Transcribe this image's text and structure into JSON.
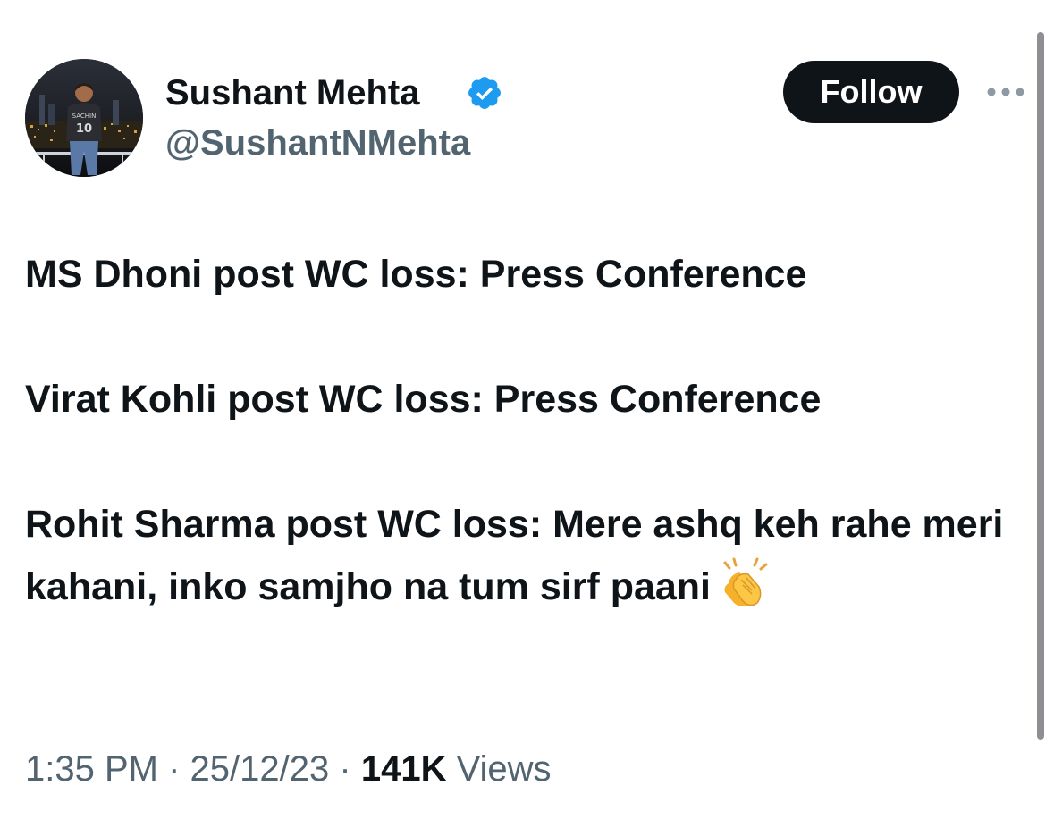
{
  "author": {
    "display_name": "Sushant Mehta",
    "handle": "@SushantNMehta",
    "verified": true,
    "avatar_jersey_text": "SACHIN",
    "avatar_jersey_number": "10"
  },
  "actions": {
    "follow_label": "Follow",
    "more_icon": "more-horizontal-icon"
  },
  "tweet": {
    "paragraphs": [
      "MS Dhoni post WC loss: Press Conference",
      "Virat Kohli post WC loss: Press Conference",
      "Rohit Sharma post WC loss: Mere ashq keh rahe meri kahani, inko samjho na tum sirf paani"
    ],
    "emoji": "clapping-hands-emoji"
  },
  "meta": {
    "time": "1:35 PM",
    "separator": "·",
    "date": "25/12/23",
    "views_count": "141K",
    "views_label": "Views"
  },
  "colors": {
    "text_primary": "#0f1419",
    "text_secondary": "#536471",
    "verified_blue": "#1d9bf0",
    "button_dark": "#0f1419"
  }
}
